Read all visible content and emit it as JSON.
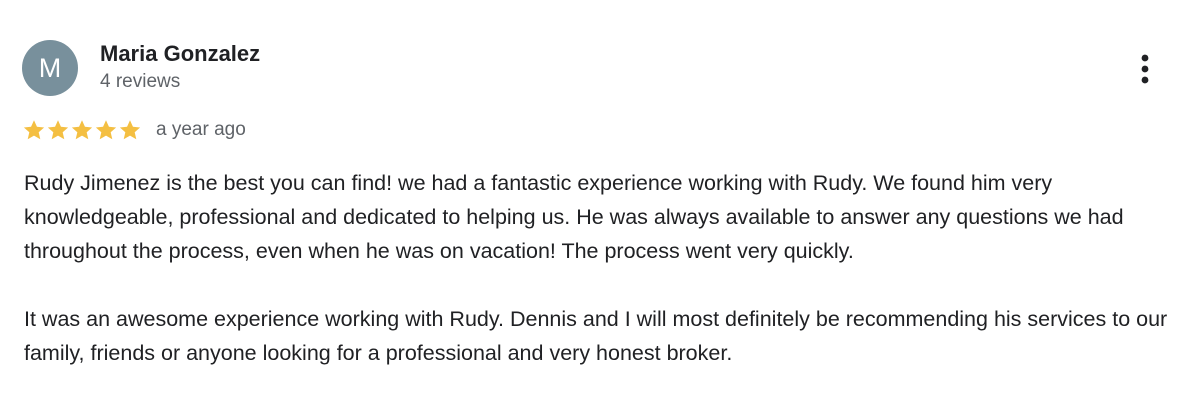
{
  "reviewer": {
    "initial": "M",
    "avatar_color": "#78909c",
    "name": "Maria Gonzalez",
    "review_count": "4 reviews"
  },
  "rating": {
    "stars": 5,
    "max_stars": 5,
    "star_color": "#f4bf42",
    "star_icon": "star-icon"
  },
  "timestamp": "a year ago",
  "menu": {
    "icon": "more-vert-icon"
  },
  "review": {
    "paragraph_1": "Rudy Jimenez is the best you can find! we had a fantastic experience working with Rudy. We found him very knowledgeable, professional and dedicated to helping us. He was always available to answer any questions we had throughout the process, even when he was on vacation! The process went very quickly.",
    "paragraph_2": "It was an awesome experience working with Rudy. Dennis and I will most definitely be recommending his services to our family, friends or anyone looking for a professional and very honest broker."
  }
}
